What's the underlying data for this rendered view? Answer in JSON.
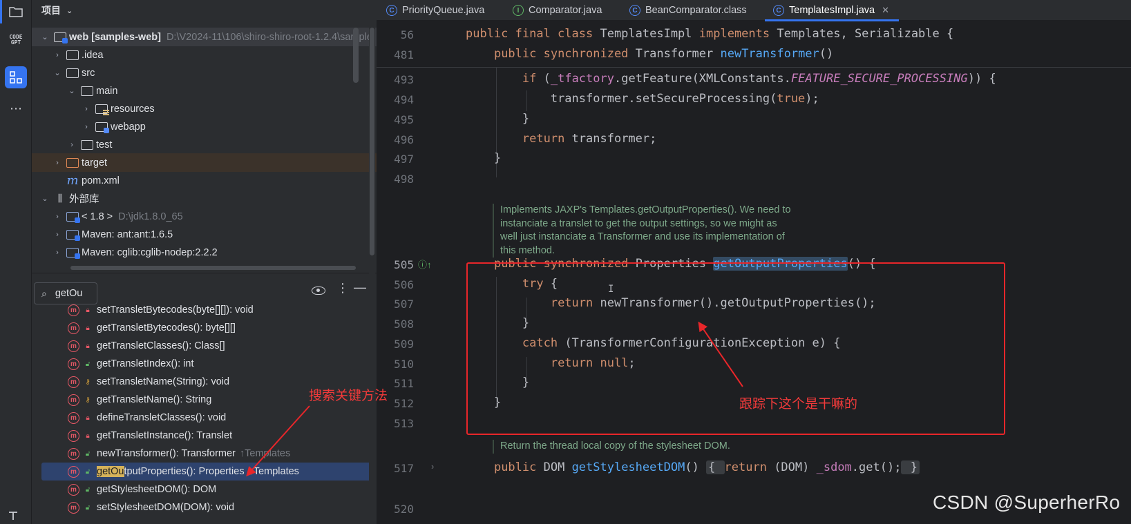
{
  "project_panel": {
    "title": "项目",
    "tree": [
      {
        "label": "web [samples-web]",
        "path": "D:\\V2024-11\\106\\shiro-shiro-root-1.2.4\\sample"
      },
      {
        "label": ".idea"
      },
      {
        "label": "src"
      },
      {
        "label": "main"
      },
      {
        "label": "resources"
      },
      {
        "label": "webapp"
      },
      {
        "label": "test"
      },
      {
        "label": "target"
      },
      {
        "label": "pom.xml"
      },
      {
        "label": "外部库"
      },
      {
        "label": "< 1.8 >",
        "path": "D:\\jdk1.8.0_65"
      },
      {
        "label": "Maven: ant:ant:1.6.5"
      },
      {
        "label": "Maven: cglib:cglib-nodep:2.2.2"
      }
    ]
  },
  "structure_panel": {
    "search_query": "getOu",
    "methods": [
      {
        "name": "setTransletBytecodes(byte[][]): void",
        "from": ""
      },
      {
        "name": "getTransletBytecodes(): byte[][]",
        "from": ""
      },
      {
        "name": "getTransletClasses(): Class[]",
        "from": ""
      },
      {
        "name": "getTransletIndex(): int",
        "from": ""
      },
      {
        "name": "setTransletName(String): void",
        "from": ""
      },
      {
        "name": "getTransletName(): String",
        "from": ""
      },
      {
        "name": "defineTransletClasses(): void",
        "from": ""
      },
      {
        "name": "getTransletInstance(): Translet",
        "from": ""
      },
      {
        "name": "newTransformer(): Transformer",
        "from": "↑Templates"
      },
      {
        "name_match": "getOu",
        "name_rest": "tputProperties(): Properties",
        "from": "↑Templates"
      },
      {
        "name": "getStylesheetDOM(): DOM",
        "from": ""
      },
      {
        "name": "setStylesheetDOM(DOM): void",
        "from": ""
      }
    ]
  },
  "tabs": [
    {
      "label": "PriorityQueue.java",
      "icon": "class-icon"
    },
    {
      "label": "Comparator.java",
      "icon": "interface-icon"
    },
    {
      "label": "BeanComparator.class",
      "icon": "class-icon"
    },
    {
      "label": "TemplatesImpl.java",
      "icon": "class-icon",
      "active": true,
      "close": "✕"
    }
  ],
  "editor": {
    "line_numbers": [
      "56",
      "481",
      "493",
      "494",
      "495",
      "496",
      "497",
      "498",
      "505",
      "506",
      "507",
      "508",
      "509",
      "510",
      "511",
      "512",
      "513",
      "517",
      "520"
    ],
    "doc_505": "Implements JAXP's Templates.getOutputProperties(). We need to instanciate a translet to get the output settings, so we might as well just instanciate a Transformer and use its implementation of this method.",
    "doc_517": "Return the thread local copy of the stylesheet DOM."
  },
  "annotations": {
    "search_note": "搜索关键方法",
    "trace_note": "跟踪下这个是干嘛的",
    "watermark": "CSDN @SuperherRo"
  },
  "colors": {
    "annotation_red": "#e8262a",
    "accent_blue": "#3574f0",
    "keyword": "#cf8e6d",
    "method": "#56a8f5",
    "constant": "#c77dbb"
  }
}
